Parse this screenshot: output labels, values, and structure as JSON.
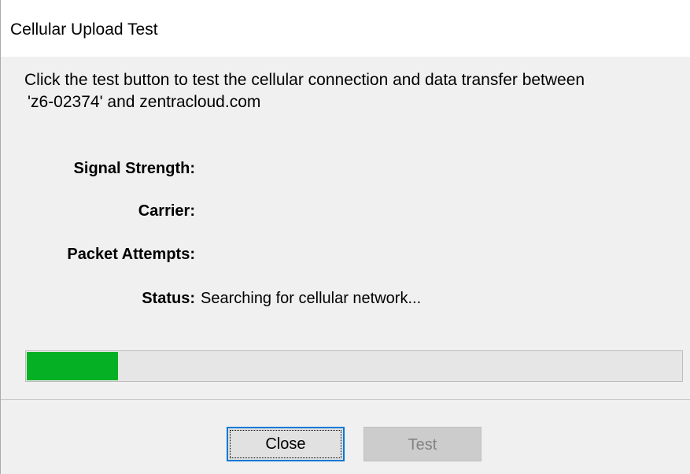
{
  "window": {
    "title": "Cellular Upload Test"
  },
  "description": {
    "line1": "Click the test button to test the cellular connection and data transfer between",
    "line2": "'z6-02374' and zentracloud.com"
  },
  "fields": {
    "signal_strength": {
      "label": "Signal Strength:",
      "value": ""
    },
    "carrier": {
      "label": "Carrier:",
      "value": ""
    },
    "packet_attempts": {
      "label": "Packet Attempts:",
      "value": ""
    },
    "status": {
      "label": "Status:",
      "value": "Searching for cellular network..."
    }
  },
  "progress": {
    "fraction": 0.14,
    "color": "#06b025"
  },
  "buttons": {
    "close_label": "Close",
    "test_label": "Test",
    "test_enabled": false
  }
}
